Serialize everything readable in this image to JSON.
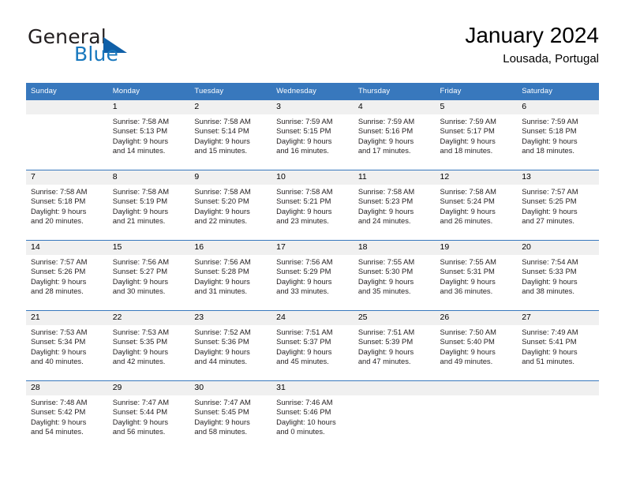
{
  "brand": {
    "name_part1": "General",
    "name_part2": "Blue",
    "triangle_color": "#1060a8",
    "blue_color": "#1878be"
  },
  "header": {
    "title": "January 2024",
    "location": "Lousada, Portugal"
  },
  "theme": {
    "header_bg": "#3878bd",
    "daynum_bg": "#f0f0f0",
    "text": "#231f20"
  },
  "weekdays": [
    "Sunday",
    "Monday",
    "Tuesday",
    "Wednesday",
    "Thursday",
    "Friday",
    "Saturday"
  ],
  "weeks": [
    [
      {
        "day": "",
        "lines": []
      },
      {
        "day": "1",
        "lines": [
          "Sunrise: 7:58 AM",
          "Sunset: 5:13 PM",
          "Daylight: 9 hours",
          "and 14 minutes."
        ]
      },
      {
        "day": "2",
        "lines": [
          "Sunrise: 7:58 AM",
          "Sunset: 5:14 PM",
          "Daylight: 9 hours",
          "and 15 minutes."
        ]
      },
      {
        "day": "3",
        "lines": [
          "Sunrise: 7:59 AM",
          "Sunset: 5:15 PM",
          "Daylight: 9 hours",
          "and 16 minutes."
        ]
      },
      {
        "day": "4",
        "lines": [
          "Sunrise: 7:59 AM",
          "Sunset: 5:16 PM",
          "Daylight: 9 hours",
          "and 17 minutes."
        ]
      },
      {
        "day": "5",
        "lines": [
          "Sunrise: 7:59 AM",
          "Sunset: 5:17 PM",
          "Daylight: 9 hours",
          "and 18 minutes."
        ]
      },
      {
        "day": "6",
        "lines": [
          "Sunrise: 7:59 AM",
          "Sunset: 5:18 PM",
          "Daylight: 9 hours",
          "and 18 minutes."
        ]
      }
    ],
    [
      {
        "day": "7",
        "lines": [
          "Sunrise: 7:58 AM",
          "Sunset: 5:18 PM",
          "Daylight: 9 hours",
          "and 20 minutes."
        ]
      },
      {
        "day": "8",
        "lines": [
          "Sunrise: 7:58 AM",
          "Sunset: 5:19 PM",
          "Daylight: 9 hours",
          "and 21 minutes."
        ]
      },
      {
        "day": "9",
        "lines": [
          "Sunrise: 7:58 AM",
          "Sunset: 5:20 PM",
          "Daylight: 9 hours",
          "and 22 minutes."
        ]
      },
      {
        "day": "10",
        "lines": [
          "Sunrise: 7:58 AM",
          "Sunset: 5:21 PM",
          "Daylight: 9 hours",
          "and 23 minutes."
        ]
      },
      {
        "day": "11",
        "lines": [
          "Sunrise: 7:58 AM",
          "Sunset: 5:23 PM",
          "Daylight: 9 hours",
          "and 24 minutes."
        ]
      },
      {
        "day": "12",
        "lines": [
          "Sunrise: 7:58 AM",
          "Sunset: 5:24 PM",
          "Daylight: 9 hours",
          "and 26 minutes."
        ]
      },
      {
        "day": "13",
        "lines": [
          "Sunrise: 7:57 AM",
          "Sunset: 5:25 PM",
          "Daylight: 9 hours",
          "and 27 minutes."
        ]
      }
    ],
    [
      {
        "day": "14",
        "lines": [
          "Sunrise: 7:57 AM",
          "Sunset: 5:26 PM",
          "Daylight: 9 hours",
          "and 28 minutes."
        ]
      },
      {
        "day": "15",
        "lines": [
          "Sunrise: 7:56 AM",
          "Sunset: 5:27 PM",
          "Daylight: 9 hours",
          "and 30 minutes."
        ]
      },
      {
        "day": "16",
        "lines": [
          "Sunrise: 7:56 AM",
          "Sunset: 5:28 PM",
          "Daylight: 9 hours",
          "and 31 minutes."
        ]
      },
      {
        "day": "17",
        "lines": [
          "Sunrise: 7:56 AM",
          "Sunset: 5:29 PM",
          "Daylight: 9 hours",
          "and 33 minutes."
        ]
      },
      {
        "day": "18",
        "lines": [
          "Sunrise: 7:55 AM",
          "Sunset: 5:30 PM",
          "Daylight: 9 hours",
          "and 35 minutes."
        ]
      },
      {
        "day": "19",
        "lines": [
          "Sunrise: 7:55 AM",
          "Sunset: 5:31 PM",
          "Daylight: 9 hours",
          "and 36 minutes."
        ]
      },
      {
        "day": "20",
        "lines": [
          "Sunrise: 7:54 AM",
          "Sunset: 5:33 PM",
          "Daylight: 9 hours",
          "and 38 minutes."
        ]
      }
    ],
    [
      {
        "day": "21",
        "lines": [
          "Sunrise: 7:53 AM",
          "Sunset: 5:34 PM",
          "Daylight: 9 hours",
          "and 40 minutes."
        ]
      },
      {
        "day": "22",
        "lines": [
          "Sunrise: 7:53 AM",
          "Sunset: 5:35 PM",
          "Daylight: 9 hours",
          "and 42 minutes."
        ]
      },
      {
        "day": "23",
        "lines": [
          "Sunrise: 7:52 AM",
          "Sunset: 5:36 PM",
          "Daylight: 9 hours",
          "and 44 minutes."
        ]
      },
      {
        "day": "24",
        "lines": [
          "Sunrise: 7:51 AM",
          "Sunset: 5:37 PM",
          "Daylight: 9 hours",
          "and 45 minutes."
        ]
      },
      {
        "day": "25",
        "lines": [
          "Sunrise: 7:51 AM",
          "Sunset: 5:39 PM",
          "Daylight: 9 hours",
          "and 47 minutes."
        ]
      },
      {
        "day": "26",
        "lines": [
          "Sunrise: 7:50 AM",
          "Sunset: 5:40 PM",
          "Daylight: 9 hours",
          "and 49 minutes."
        ]
      },
      {
        "day": "27",
        "lines": [
          "Sunrise: 7:49 AM",
          "Sunset: 5:41 PM",
          "Daylight: 9 hours",
          "and 51 minutes."
        ]
      }
    ],
    [
      {
        "day": "28",
        "lines": [
          "Sunrise: 7:48 AM",
          "Sunset: 5:42 PM",
          "Daylight: 9 hours",
          "and 54 minutes."
        ]
      },
      {
        "day": "29",
        "lines": [
          "Sunrise: 7:47 AM",
          "Sunset: 5:44 PM",
          "Daylight: 9 hours",
          "and 56 minutes."
        ]
      },
      {
        "day": "30",
        "lines": [
          "Sunrise: 7:47 AM",
          "Sunset: 5:45 PM",
          "Daylight: 9 hours",
          "and 58 minutes."
        ]
      },
      {
        "day": "31",
        "lines": [
          "Sunrise: 7:46 AM",
          "Sunset: 5:46 PM",
          "Daylight: 10 hours",
          "and 0 minutes."
        ]
      },
      {
        "day": "",
        "lines": []
      },
      {
        "day": "",
        "lines": []
      },
      {
        "day": "",
        "lines": []
      }
    ]
  ]
}
